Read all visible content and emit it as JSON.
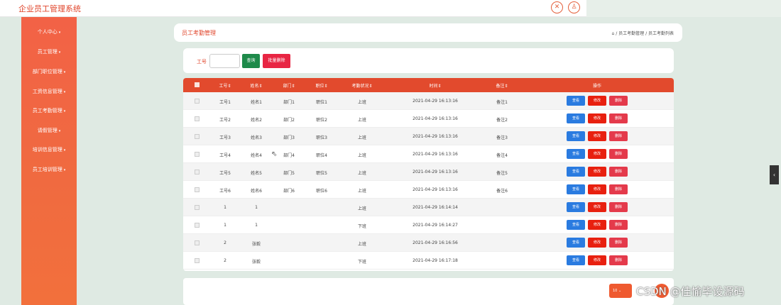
{
  "app": {
    "title": "企业员工管理系统"
  },
  "header_icons": [
    {
      "icon": "close-icon",
      "glyph": "✕"
    },
    {
      "icon": "user-icon",
      "glyph": "♙"
    }
  ],
  "sidebar": {
    "items": [
      {
        "label": "个人中心"
      },
      {
        "label": "员工管理"
      },
      {
        "label": "部门职位管理"
      },
      {
        "label": "工资信息管理"
      },
      {
        "label": "员工考勤管理"
      },
      {
        "label": "请假管理"
      },
      {
        "label": "培训信息管理"
      },
      {
        "label": "员工培训管理"
      }
    ]
  },
  "page": {
    "title": "员工考勤管理",
    "breadcrumb_home_icon": "home-icon",
    "breadcrumb": "⌂  /  员工考勤管理  /  员工考勤列表"
  },
  "search": {
    "label": "工号",
    "value": "",
    "query_label": "查询",
    "batch_delete_label": "批量删除"
  },
  "table": {
    "columns": [
      "工号",
      "姓名",
      "部门",
      "职位",
      "考勤状况",
      "时间",
      "备注",
      "操作"
    ],
    "sort_mark": "⇕",
    "actions": {
      "view": "查看",
      "edit": "修改",
      "delete": "删除"
    },
    "rows": [
      {
        "id": "工号1",
        "name": "姓名1",
        "dept": "部门1",
        "pos": "职位1",
        "status": "上班",
        "time": "2021-04-29 16:13:16",
        "note": "备注1"
      },
      {
        "id": "工号2",
        "name": "姓名2",
        "dept": "部门2",
        "pos": "职位2",
        "status": "上班",
        "time": "2021-04-29 16:13:16",
        "note": "备注2"
      },
      {
        "id": "工号3",
        "name": "姓名3",
        "dept": "部门3",
        "pos": "职位3",
        "status": "上班",
        "time": "2021-04-29 16:13:16",
        "note": "备注3"
      },
      {
        "id": "工号4",
        "name": "姓名4",
        "dept": "部门4",
        "pos": "职位4",
        "status": "上班",
        "time": "2021-04-29 16:13:16",
        "note": "备注4"
      },
      {
        "id": "工号5",
        "name": "姓名5",
        "dept": "部门5",
        "pos": "职位5",
        "status": "上班",
        "time": "2021-04-29 16:13:16",
        "note": "备注5"
      },
      {
        "id": "工号6",
        "name": "姓名6",
        "dept": "部门6",
        "pos": "职位6",
        "status": "上班",
        "time": "2021-04-29 16:13:16",
        "note": "备注6"
      },
      {
        "id": "1",
        "name": "1",
        "dept": "",
        "pos": "",
        "status": "上班",
        "time": "2021-04-29 16:14:14",
        "note": ""
      },
      {
        "id": "1",
        "name": "1",
        "dept": "",
        "pos": "",
        "status": "下班",
        "time": "2021-04-29 16:14:27",
        "note": ""
      },
      {
        "id": "2",
        "name": "张毅",
        "dept": "",
        "pos": "",
        "status": "上班",
        "time": "2021-04-29 16:16:56",
        "note": ""
      },
      {
        "id": "2",
        "name": "张毅",
        "dept": "",
        "pos": "",
        "status": "下班",
        "time": "2021-04-29 16:17:18",
        "note": ""
      }
    ]
  },
  "pagination": {
    "page_size": "10",
    "current": "1"
  },
  "watermark": "CSDN @佳愉毕设源码",
  "colors": {
    "accent": "#e24a2d",
    "sidebar": "#f06a40",
    "query": "#1e8a4a",
    "view": "#2a7be0",
    "edit": "#e8200f",
    "delete": "#e43a4b"
  }
}
